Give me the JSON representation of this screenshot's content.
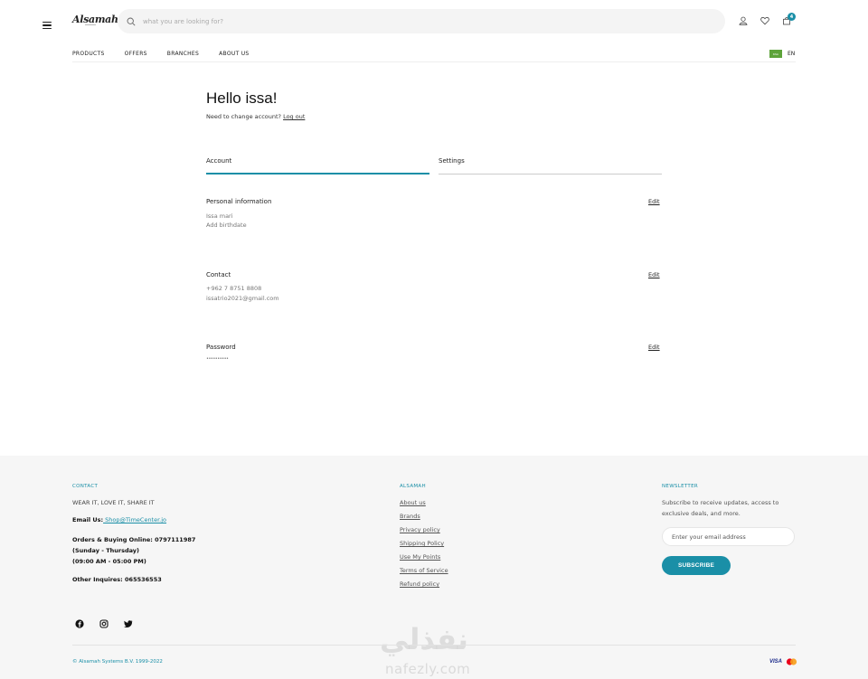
{
  "header": {
    "logo": "Alsamah",
    "search_placeholder": "what you are looking for?",
    "cart_count": "4",
    "nav": [
      "PRODUCTS",
      "OFFERS",
      "BRANCHES",
      "ABOUT US"
    ],
    "flag_text": "KSA",
    "language": "EN"
  },
  "account": {
    "greeting": "Hello issa!",
    "change_account_text": "Need to change account?",
    "logout_label": "Log out",
    "tabs": [
      "Account",
      "Settings"
    ],
    "sections": [
      {
        "title": "Personal information",
        "edit": "Edit",
        "lines": [
          "Issa mari",
          "Add birthdate"
        ]
      },
      {
        "title": "Contact",
        "edit": "Edit",
        "lines": [
          "+962 7 8751 8808",
          "issatrio2021@gmail.com"
        ]
      },
      {
        "title": "Password",
        "edit": "Edit",
        "lines": [
          "••••••••••"
        ]
      }
    ]
  },
  "footer": {
    "contact": {
      "heading": "CONTACT",
      "tagline": "WEAR IT, LOVE IT, SHARE IT",
      "email_label": "Email Us:",
      "email": " Shop@TimeCenter.jo",
      "orders_line1": "Orders & Buying Online: 0797111987",
      "orders_line2": "(Sunday - Thursday)",
      "orders_line3": "(09:00 AM - 05:00 PM)",
      "other": "Other Inquires: 065536553"
    },
    "alsamah": {
      "heading": "ALSAMAH",
      "links": [
        "About us",
        "Brands",
        "Privacy policy",
        "Shipping Policy",
        "Use My Points",
        "Terms of Service",
        "Refund policy"
      ]
    },
    "newsletter": {
      "heading": "NEWSLETTER",
      "text": "Subscribe to receive updates, access to exclusive deals, and more.",
      "email_placeholder": "Enter your email address",
      "button": "SUBSCRIBE"
    },
    "copyright": "© Alsamah Systems B.V. 1999-2022",
    "payment_visa": "VISA",
    "watermark_ar": "نفذلي",
    "watermark_en": "nafezly.com"
  },
  "colors": {
    "accent": "#1a8fa7",
    "footer_bg": "#f6f6f6"
  }
}
